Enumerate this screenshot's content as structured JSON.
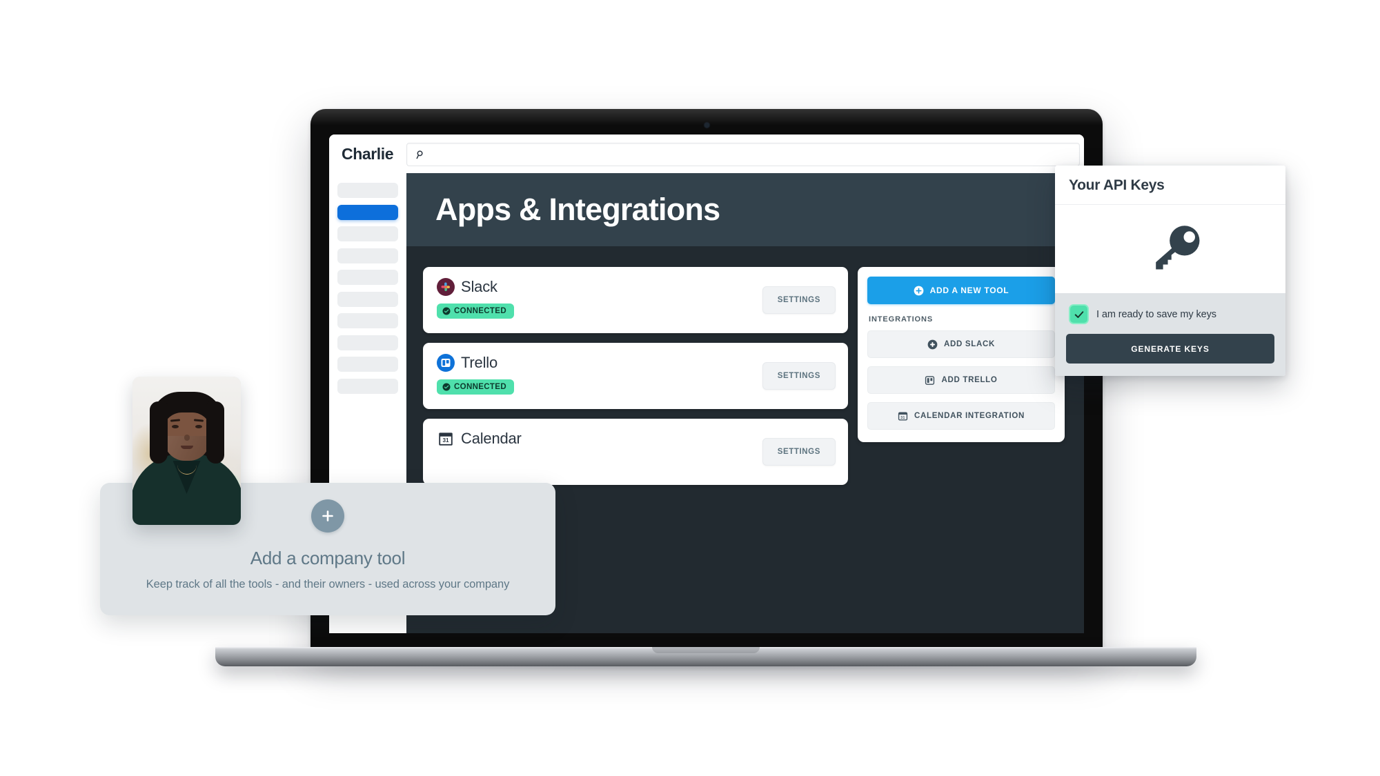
{
  "product": {
    "brand": "Charlie"
  },
  "search": {
    "value": "",
    "placeholder": "",
    "icon": "search-icon"
  },
  "sidebar": {
    "items": [
      {
        "label": "",
        "active": false
      },
      {
        "label": "",
        "active": true
      },
      {
        "label": "",
        "active": false
      },
      {
        "label": "",
        "active": false
      },
      {
        "label": "",
        "active": false
      },
      {
        "label": "",
        "active": false
      },
      {
        "label": "",
        "active": false
      },
      {
        "label": "",
        "active": false
      },
      {
        "label": "",
        "active": false
      },
      {
        "label": "",
        "active": false
      }
    ]
  },
  "page": {
    "title": "Apps & Integrations"
  },
  "apps": [
    {
      "name": "Slack",
      "icon": "slack-icon",
      "status": "CONNECTED",
      "status_icon": "check-circle-icon",
      "action": "SETTINGS"
    },
    {
      "name": "Trello",
      "icon": "trello-icon",
      "status": "CONNECTED",
      "status_icon": "check-circle-icon",
      "action": "SETTINGS"
    },
    {
      "name": "Calendar",
      "icon": "calendar-icon",
      "status": "",
      "status_icon": "",
      "action": "SETTINGS"
    }
  ],
  "integrations_panel": {
    "add_tool_label": "ADD A NEW TOOL",
    "add_tool_icon": "plus-circle-icon",
    "section_label": "INTEGRATIONS",
    "buttons": [
      {
        "label": "ADD SLACK",
        "icon": "slack-mono-icon"
      },
      {
        "label": "ADD TRELLO",
        "icon": "trello-mono-icon"
      },
      {
        "label": "CALENDAR INTEGRATION",
        "icon": "calendar-mono-icon"
      }
    ]
  },
  "api_panel": {
    "title": "Your API Keys",
    "hero_icon": "key-icon",
    "checkbox_label": "I am ready to save my keys",
    "checkbox_checked": true,
    "button_label": "GENERATE KEYS"
  },
  "add_tool_card": {
    "icon": "plus-icon",
    "title": "Add a company tool",
    "subtitle": "Keep track of all the tools - and their owners - used across your company"
  },
  "photo": {
    "alt": "employee-portrait"
  },
  "colors": {
    "accent_blue": "#0d6fdb",
    "button_blue": "#1b9fe8",
    "header_dark": "#33424c",
    "body_dark": "#222a30",
    "connected_green": "#4fe0ac",
    "muted_text": "#5f7887"
  }
}
